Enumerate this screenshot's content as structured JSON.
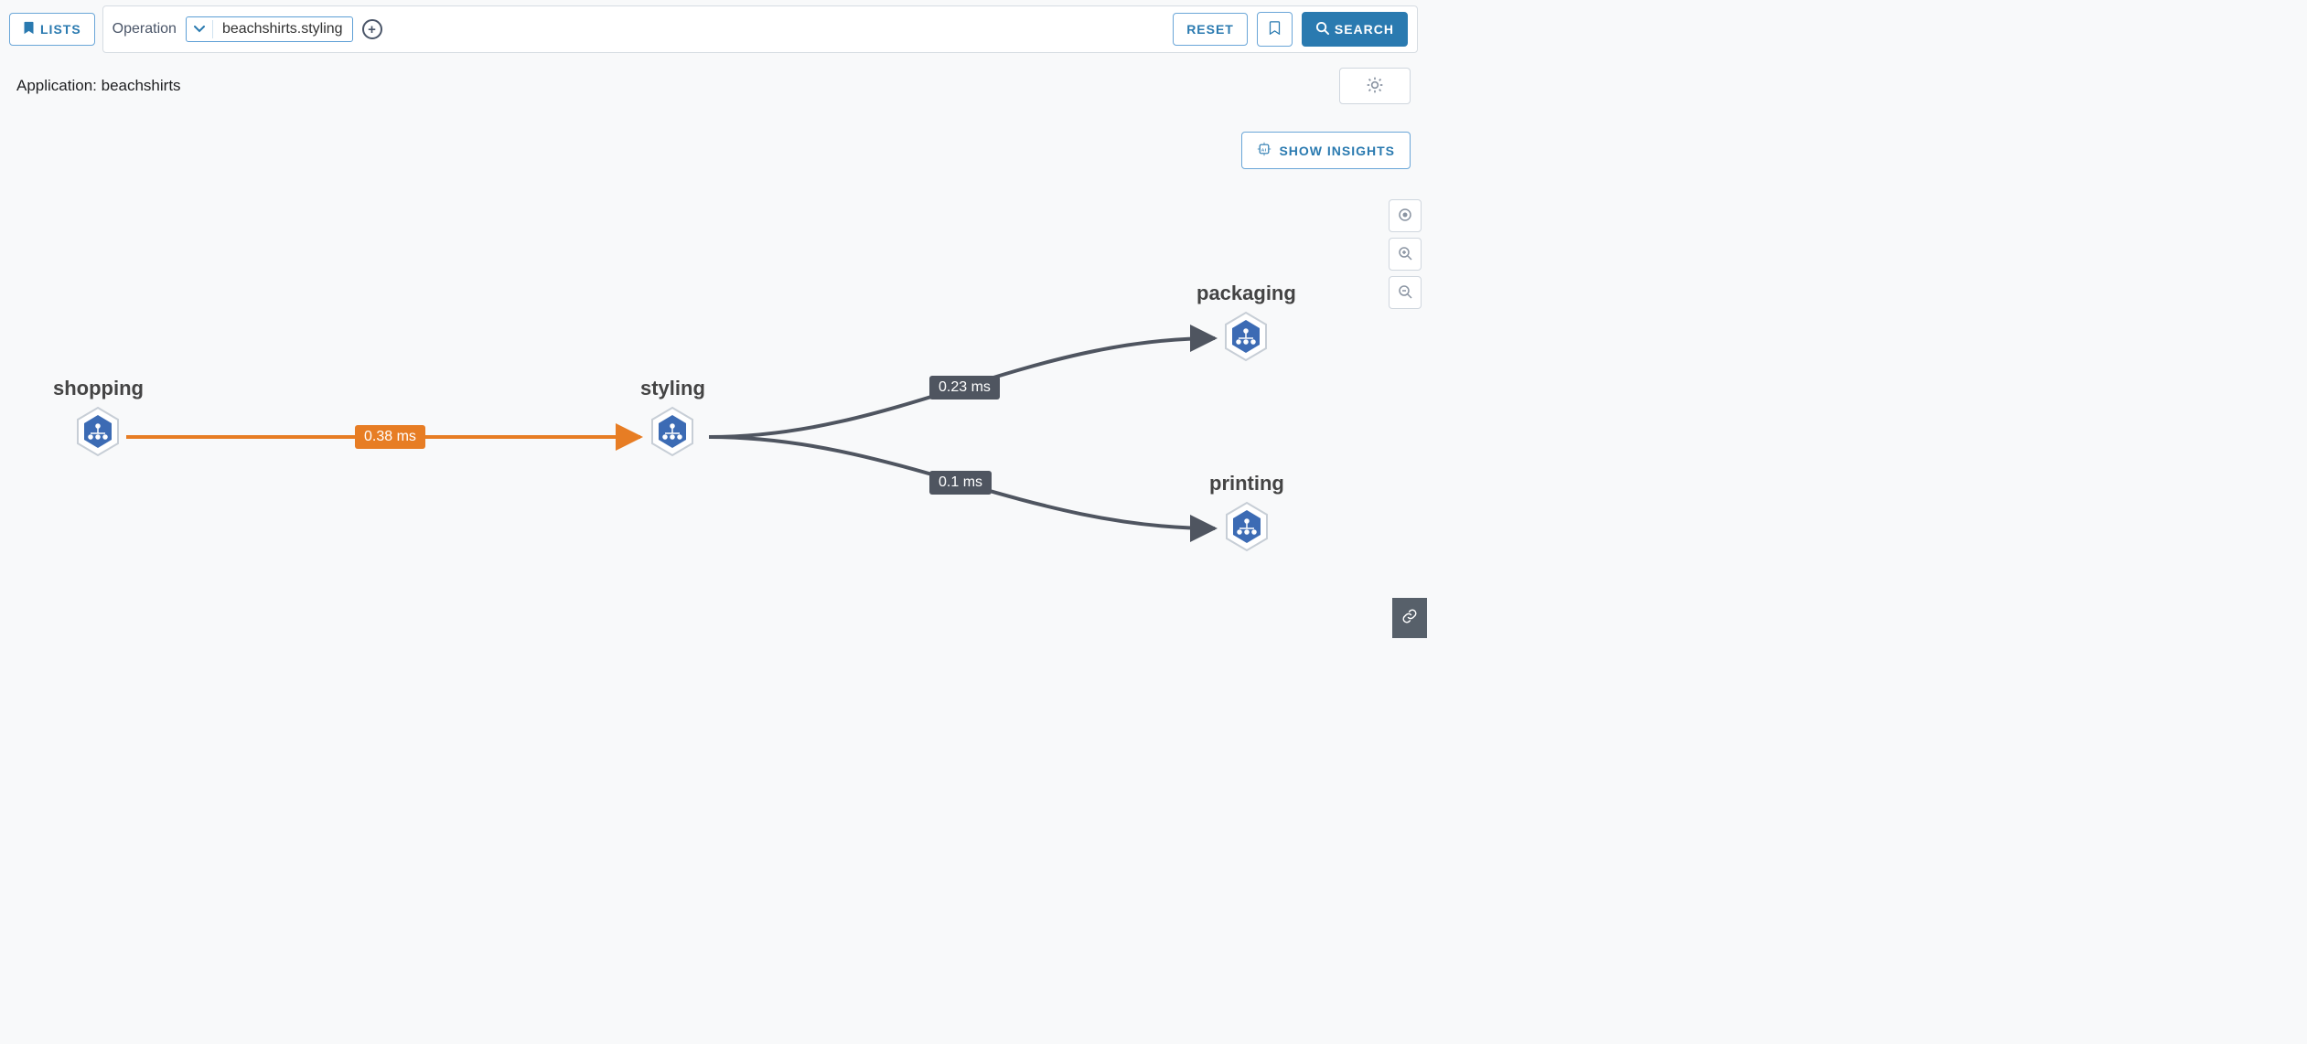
{
  "toolbar": {
    "lists_label": "LISTS",
    "filter_label": "Operation",
    "filter_value": "beachshirts.styling",
    "reset_label": "RESET",
    "search_label": "SEARCH"
  },
  "subheader": {
    "application_label": "Application: beachshirts"
  },
  "insights": {
    "button_label": "SHOW INSIGHTS"
  },
  "nodes": {
    "shopping": {
      "label": "shopping"
    },
    "styling": {
      "label": "styling"
    },
    "packaging": {
      "label": "packaging"
    },
    "printing": {
      "label": "printing"
    }
  },
  "edges": {
    "shopping_styling": {
      "latency": "0.38 ms"
    },
    "styling_packaging": {
      "latency": "0.23 ms"
    },
    "styling_printing": {
      "latency": "0.1 ms"
    }
  },
  "icons": {
    "lists": "bookmark-icon",
    "chevron_down": "chevron-down-icon",
    "plus": "plus-icon",
    "bookmark": "bookmark-outline-icon",
    "search": "search-icon",
    "settings": "gear-icon",
    "insights": "ai-chip-icon",
    "center": "target-icon",
    "zoom_in": "zoom-in-icon",
    "zoom_out": "zoom-out-icon",
    "share": "link-icon",
    "service": "kubernetes-hex-icon"
  },
  "colors": {
    "accent_blue": "#2a7ab0",
    "edge_orange": "#e77d24",
    "edge_gray": "#4f5560",
    "node_icon_blue": "#3c6bb4"
  }
}
